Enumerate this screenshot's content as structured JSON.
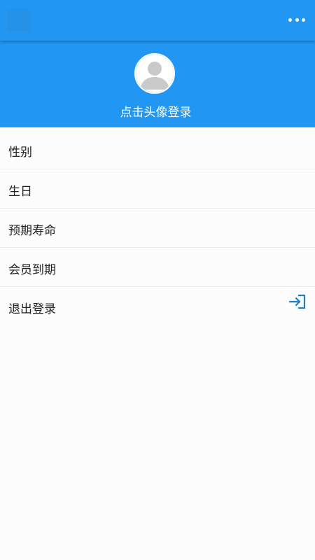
{
  "header": {
    "app_icon": "app-logo-icon",
    "more_icon": "more-horizontal-icon",
    "background_color": "#2196f3"
  },
  "profile": {
    "avatar_icon": "user-avatar-icon",
    "login_prompt": "点击头像登录"
  },
  "menu": {
    "items": [
      {
        "label": "性别"
      },
      {
        "label": "生日"
      },
      {
        "label": "预期寿命"
      },
      {
        "label": "会员到期"
      },
      {
        "label": "退出登录",
        "icon": "logout-icon"
      }
    ]
  },
  "colors": {
    "accent": "#2196f3",
    "logout_icon": "#1a7fc4",
    "background": "#fcfcfc"
  }
}
